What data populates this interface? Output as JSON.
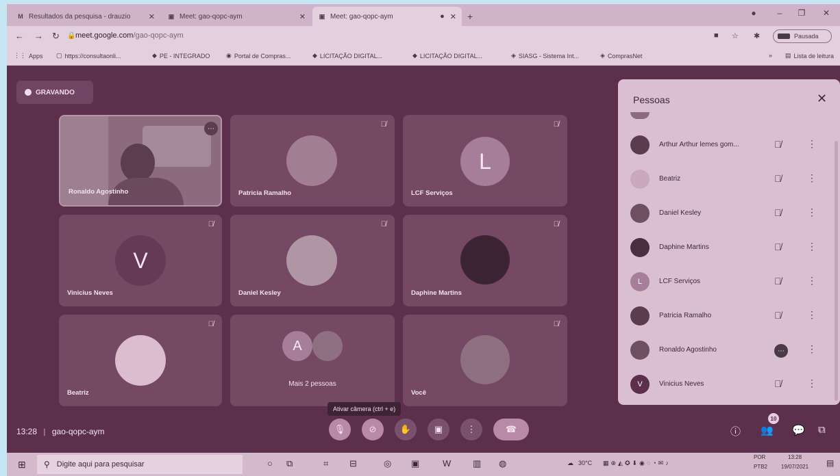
{
  "browser": {
    "tabs": [
      {
        "icon": "gmail-icon",
        "label": "Resultados da pesquisa - drauzio"
      },
      {
        "icon": "meet-icon",
        "label": "Meet: gao-qopc-aym"
      },
      {
        "icon": "meet-icon",
        "label": "Meet: gao-qopc-aym"
      }
    ],
    "url_host": "meet.google.com",
    "url_path": "/gao-qopc-aym",
    "profile_status": "Pausada",
    "bookmarks": [
      "Apps",
      "https://consultaonli...",
      "PE - INTEGRADO",
      "Portal de Compras...",
      "LICITAÇÃO DIGITAL...",
      "LICITAÇÃO DIGITAL...",
      "SIASG - Sistema Int...",
      "ComprasNet"
    ],
    "reading_list": "Lista de leitura"
  },
  "meet": {
    "recording_label": "GRAVANDO",
    "tiles": [
      {
        "name": "Ronaldo Agostinho"
      },
      {
        "name": "Patricia Ramalho"
      },
      {
        "name": "LCF Serviços",
        "initial": "L"
      },
      {
        "name": "Vinicius Neves",
        "initial": "V"
      },
      {
        "name": "Daniel Kesley"
      },
      {
        "name": "Daphine Martins"
      },
      {
        "name": "Beatriz"
      },
      {
        "name": "Mais 2 pessoas",
        "initial": "A"
      },
      {
        "name": "Você"
      }
    ],
    "tooltip": "Ativar câmera (ctrl + e)",
    "time": "13:28",
    "meeting_code": "gao-qopc-aym",
    "participant_count": "10"
  },
  "panel": {
    "title": "Pessoas",
    "people": [
      {
        "name": "Arthur Arthur lemes gom...",
        "avatar": "photo"
      },
      {
        "name": "Beatriz",
        "avatar": "blank"
      },
      {
        "name": "Daniel Kesley",
        "avatar": "photo"
      },
      {
        "name": "Daphine Martins",
        "avatar": "photo"
      },
      {
        "name": "LCF Serviços",
        "avatar": "letter",
        "initial": "L"
      },
      {
        "name": "Patricia Ramalho",
        "avatar": "photo"
      },
      {
        "name": "Ronaldo Agostinho",
        "avatar": "photo"
      },
      {
        "name": "Vinicius Neves",
        "avatar": "letter",
        "initial": "V"
      }
    ]
  },
  "taskbar": {
    "search_placeholder": "Digite aqui para pesquisar",
    "temperature": "30°C",
    "lang": "POR",
    "lang2": "PTB2",
    "clock_time": "13:28",
    "clock_date": "19/07/2021"
  }
}
